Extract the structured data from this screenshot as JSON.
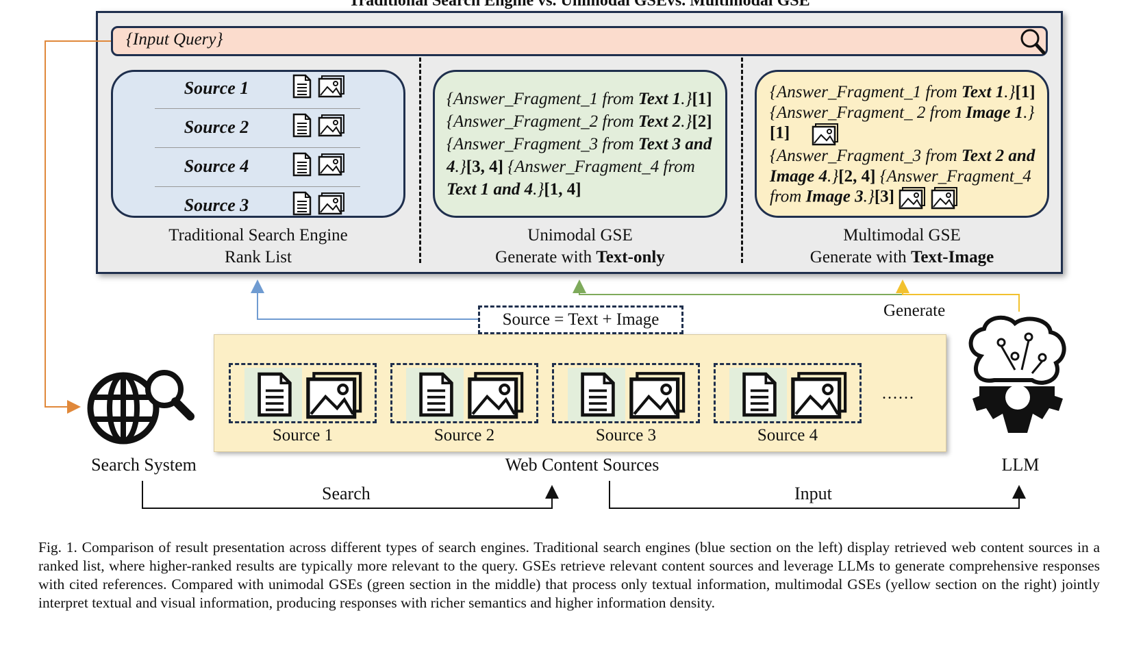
{
  "title": "Traditional Search Engine vs. Unimodal GSEvs. Multimodal GSE",
  "query": "{Input Query}",
  "traditional": {
    "sources": [
      "Source 1",
      "Source 2",
      "Source 4",
      "Source 3"
    ],
    "label_line1": "Traditional Search Engine",
    "label_line2": "Rank List"
  },
  "unimodal": {
    "answer": [
      {
        "t": "{Answer_Fragment_1 from ",
        "s": "i"
      },
      {
        "t": "Text 1",
        "s": "b"
      },
      {
        "t": ".}",
        "s": "i"
      },
      {
        "t": "[1] ",
        "s": "r"
      },
      {
        "t": "{Answer_Fragment_2 from ",
        "s": "i"
      },
      {
        "t": "Text 2",
        "s": "b"
      },
      {
        "t": ".}",
        "s": "i"
      },
      {
        "t": "[2] ",
        "s": "r"
      },
      {
        "t": "{Answer_Fragment_3 from ",
        "s": "i"
      },
      {
        "t": "Text 3 and 4",
        "s": "b"
      },
      {
        "t": ".}",
        "s": "i"
      },
      {
        "t": "[3, 4] ",
        "s": "r"
      },
      {
        "t": "{Answer_Fragment_4 from ",
        "s": "i"
      },
      {
        "t": "Text 1 and 4",
        "s": "b"
      },
      {
        "t": ".}",
        "s": "i"
      },
      {
        "t": "[1, 4]",
        "s": "r"
      }
    ],
    "label_line1": "Unimodal GSE",
    "label_line2_prefix": "Generate with ",
    "label_line2_bold": "Text-only"
  },
  "multimodal": {
    "label_line1": "Multimodal GSE",
    "label_line2_prefix": "Generate with ",
    "label_line2_bold": "Text-Image",
    "frag1": "{Answer_Fragment_1 from ",
    "frag1_b": "Text 1",
    "frag1_end": ".}",
    "ref1": "[1]",
    "frag2": "{Answer_Fragment_ 2 from ",
    "frag2_b": "Image 1",
    "frag2_end": ".}",
    "ref2": "[1]",
    "frag3": "{Answer_Fragment_3 from ",
    "frag3_b": "Text 2 and Image 4",
    "frag3_end": ".}",
    "ref3": "[2, 4]",
    "frag4": "{Answer_Fragment_4 from ",
    "frag4_b": "Image 3",
    "frag4_end": ".}",
    "ref4": "[3]"
  },
  "source_eq": "Source = Text + Image",
  "generate_label": "Generate",
  "web_sources": [
    "Source 1",
    "Source 2",
    "Source 3",
    "Source 4"
  ],
  "ellipsis": "......",
  "search_system": "Search System",
  "web_content": "Web Content Sources",
  "llm": "LLM",
  "search": "Search",
  "input": "Input",
  "figure_caption": "Fig. 1.  Comparison of result presentation across different types of search engines. Traditional search engines (blue section on the left) display retrieved web content sources in a ranked list, where higher-ranked results are typically more relevant to the query. GSEs retrieve relevant content sources and leverage LLMs to generate comprehensive responses with cited references. Compared with unimodal GSEs (green section in the middle) that process only textual information, multimodal GSEs (yellow section on the right) jointly interpret textual and visual information, producing responses with richer semantics and higher information density.",
  "colors": {
    "navy": "#1f2f4d",
    "query_bg": "#fbdccd",
    "blue_card": "#dce6f2",
    "green_card": "#e3eedb",
    "yellow_card": "#fcefc6",
    "panel_bg": "#ebebeb",
    "arrow_orange": "#e0883a",
    "arrow_blue": "#6f9bd1",
    "arrow_green": "#7eaa5b",
    "arrow_yellow": "#f2c12e"
  }
}
